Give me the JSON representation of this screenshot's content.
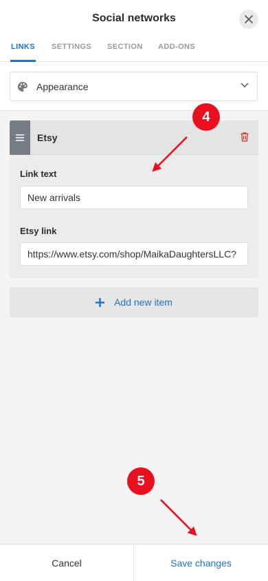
{
  "header": {
    "title": "Social networks"
  },
  "tabs": [
    {
      "label": "LINKS",
      "active": true
    },
    {
      "label": "SETTINGS",
      "active": false
    },
    {
      "label": "SECTION",
      "active": false
    },
    {
      "label": "ADD-ONS",
      "active": false
    }
  ],
  "appearance": {
    "label": "Appearance",
    "icon": "palette-icon"
  },
  "item": {
    "title": "Etsy",
    "link_text_label": "Link text",
    "link_text_value": "New arrivals",
    "link_label": "Etsy link",
    "link_value": "https://www.etsy.com/shop/MaikaDaughtersLLC?"
  },
  "add_item": {
    "label": "Add new item"
  },
  "annotations": {
    "badge_4": "4",
    "badge_5": "5"
  },
  "footer": {
    "cancel_label": "Cancel",
    "save_label": "Save changes"
  },
  "colors": {
    "accent": "#1a73c9",
    "badge": "#e8101e",
    "delete": "#c0392b"
  }
}
